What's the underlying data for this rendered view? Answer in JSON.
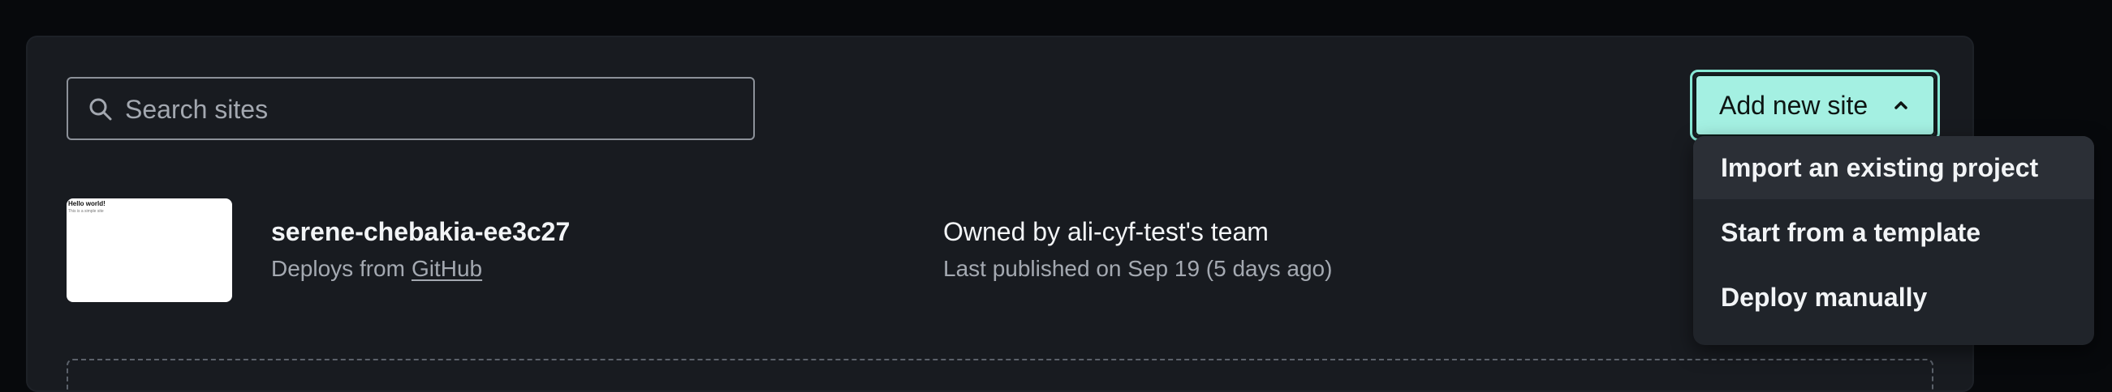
{
  "search": {
    "placeholder": "Search sites"
  },
  "toolbar": {
    "add_site_label": "Add new site"
  },
  "dropdown": {
    "items": [
      {
        "label": "Import an existing project"
      },
      {
        "label": "Start from a template"
      },
      {
        "label": "Deploy manually"
      }
    ]
  },
  "site": {
    "name": "serene-chebakia-ee3c27",
    "deploys_prefix": "Deploys from",
    "deploys_source": "GitHub",
    "owner": "Owned by ali-cyf-test's team",
    "published": "Last published on Sep 19 (5 days ago)",
    "thumbnail_title": "Hello world!",
    "thumbnail_subtitle": "This is a simple site"
  },
  "colors": {
    "background": "#07090c",
    "panel": "#181b20",
    "accent": "#a4f0e2",
    "accent_border": "#86e8d4",
    "menu": "#20242a"
  },
  "icons": {
    "search": "search-icon",
    "chevron": "chevron-up-icon"
  }
}
